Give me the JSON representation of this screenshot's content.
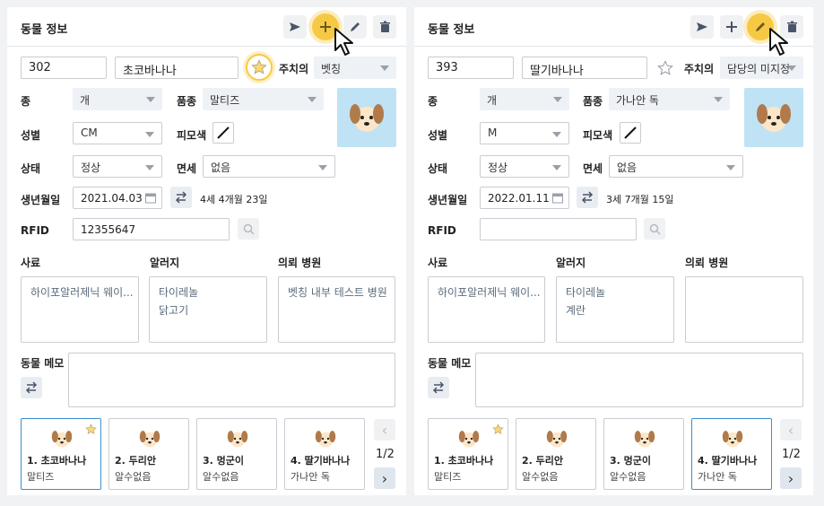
{
  "panels": [
    {
      "title": "동물 정보",
      "highlighted_action": "add",
      "id": "302",
      "name": "초코바나나",
      "favorite": true,
      "owner_label": "주치의",
      "owner_value": "벳칭",
      "species_label": "종",
      "species": "개",
      "breed_label": "품종",
      "breed": "말티즈",
      "sex_label": "성별",
      "sex": "CM",
      "coat_label": "피모색",
      "status_label": "상태",
      "status": "정상",
      "exempt_label": "면세",
      "exempt": "없음",
      "birth_label": "생년월일",
      "birth": "2021.04.03",
      "age": "4세 4개월 23일",
      "rfid_label": "RFID",
      "rfid": "12355647",
      "feed_label": "사료",
      "feed": "하이포알러제닉 웨이...",
      "allergy_label": "알러지",
      "allergy_1": "타이레놀",
      "allergy_2": "닭고기",
      "hospital_label": "의뢰 병원",
      "hospital": "벳칭 내부 테스트 병원",
      "memo_label": "동물 메모",
      "memo": "",
      "cards": [
        {
          "name": "1. 초코바나나",
          "breed": "말티즈",
          "star": true,
          "selected": true
        },
        {
          "name": "2. 두리안",
          "breed": "알수없음",
          "star": false,
          "selected": false
        },
        {
          "name": "3. 멍군이",
          "breed": "알수없음",
          "star": false,
          "selected": false
        },
        {
          "name": "4. 딸기바나나",
          "breed": "가나안 독",
          "star": false,
          "selected": false
        }
      ],
      "pager": "1/2"
    },
    {
      "title": "동물 정보",
      "highlighted_action": "edit",
      "id": "393",
      "name": "딸기바나나",
      "favorite": false,
      "owner_label": "주치의",
      "owner_value": "담당의 미지정",
      "species_label": "종",
      "species": "개",
      "breed_label": "품종",
      "breed": "가나안 독",
      "sex_label": "성별",
      "sex": "M",
      "coat_label": "피모색",
      "status_label": "상태",
      "status": "정상",
      "exempt_label": "면세",
      "exempt": "없음",
      "birth_label": "생년월일",
      "birth": "2022.01.11",
      "age": "3세 7개월 15일",
      "rfid_label": "RFID",
      "rfid": "",
      "feed_label": "사료",
      "feed": "하이포알러제닉 웨이...",
      "allergy_label": "알러지",
      "allergy_1": "타이레놀",
      "allergy_2": "계란",
      "hospital_label": "의뢰 병원",
      "hospital": "",
      "memo_label": "동물 메모",
      "memo": "",
      "cards": [
        {
          "name": "1. 초코바나나",
          "breed": "말티즈",
          "star": true,
          "selected": false
        },
        {
          "name": "2. 두리안",
          "breed": "알수없음",
          "star": false,
          "selected": false
        },
        {
          "name": "3. 멍군이",
          "breed": "알수없음",
          "star": false,
          "selected": false
        },
        {
          "name": "4. 딸기바나나",
          "breed": "가나안 독",
          "star": false,
          "selected": true
        }
      ],
      "pager": "1/2"
    }
  ],
  "colors": {
    "accent": "#f6c945",
    "avatar_bg": "#bfe3f5",
    "selected_border": "#3a8fd0"
  },
  "icons": [
    "send-icon",
    "plus-icon",
    "pencil-icon",
    "trash-icon",
    "star-icon",
    "calendar-icon",
    "swap-icon",
    "search-icon",
    "dog-icon",
    "chevron-left-icon",
    "chevron-right-icon",
    "cursor-icon"
  ]
}
